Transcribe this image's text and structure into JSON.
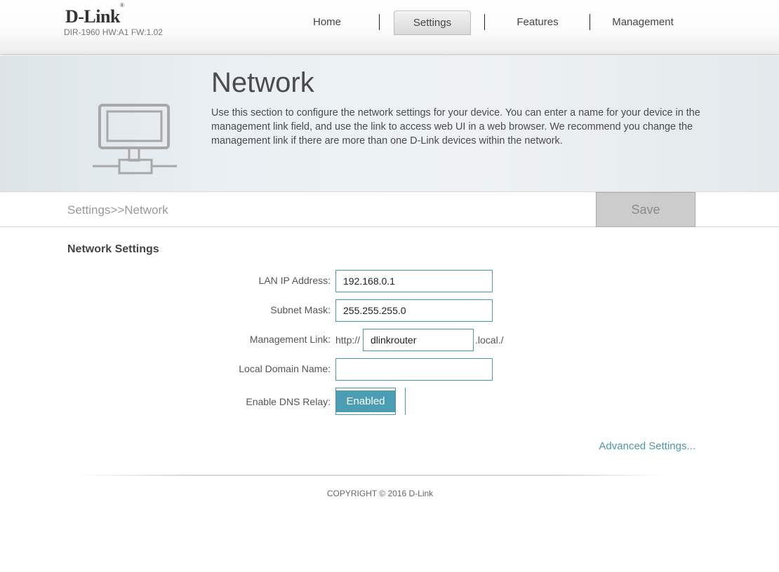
{
  "header": {
    "brand": "D-Link",
    "device_info": "DIR-1960 HW:A1 FW:1.02",
    "nav": [
      {
        "label": "Home"
      },
      {
        "label": "Settings",
        "active": true
      },
      {
        "label": "Features"
      },
      {
        "label": "Management"
      }
    ]
  },
  "banner": {
    "title": "Network",
    "description": "Use this section to configure the network settings for your device. You can enter a name for your device in the management link field, and use the link to access web UI in a web browser. We recommend you change the management link if there are more than one D-Link devices within the network.",
    "icon": "network-computer-icon"
  },
  "breadcrumb": "Settings>>Network",
  "save_label": "Save",
  "form": {
    "section_title": "Network Settings",
    "lan_ip_label": "LAN IP Address:",
    "lan_ip_value": "192.168.0.1",
    "subnet_label": "Subnet Mask:",
    "subnet_value": "255.255.255.0",
    "mgmt_label": "Management Link:",
    "mgmt_prefix": "http://",
    "mgmt_value": "dlinkrouter",
    "mgmt_suffix": ".local./",
    "domain_label": "Local Domain Name:",
    "domain_value": "",
    "dns_label": "Enable DNS Relay:",
    "dns_state": "Enabled"
  },
  "advanced_link": "Advanced Settings...",
  "footer": {
    "copyright": "COPYRIGHT © 2016 D-Link"
  },
  "colors": {
    "accent": "#4a9db3",
    "field_border": "#4a96ad",
    "link": "#4f97ab"
  }
}
